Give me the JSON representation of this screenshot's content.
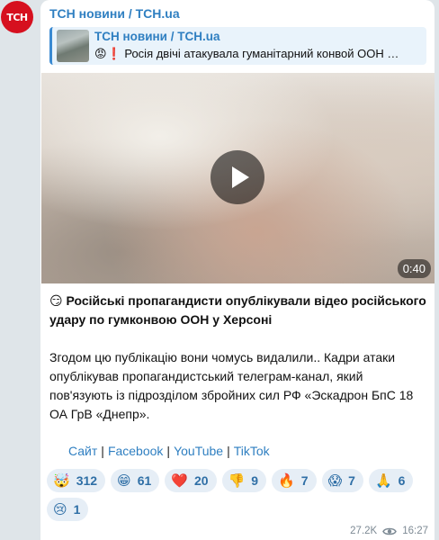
{
  "avatar_text": "ТСН",
  "channel": {
    "name": "ТСН новини / ТСН.ua"
  },
  "reply": {
    "title": "ТСН новини / ТСН.ua",
    "text": "😡❗ Росія двічі атакувала гуманітарний конвой ООН …"
  },
  "video": {
    "duration": "0:40"
  },
  "post": {
    "headline": "😏 Російські пропагандисти опублікували відео російського удару по гумконвою ООН у Херсоні",
    "body": "Згодом цю публікацію вони чомусь видалили.. Кадри атаки опублікував пропагандистський телеграм-канал, який пов'язують із підрозділом збройних сил РФ «Эскадрон БпС 18 ОА ГрВ «Днепр»."
  },
  "links": [
    "Сайт",
    "Facebook",
    "YouTube",
    "TikTok"
  ],
  "reactions": [
    {
      "emoji": "🤯",
      "count": "312"
    },
    {
      "emoji": "😁",
      "count": "61"
    },
    {
      "emoji": "❤️",
      "count": "20"
    },
    {
      "emoji": "👎",
      "count": "9"
    },
    {
      "emoji": "🔥",
      "count": "7"
    },
    {
      "emoji": "😱",
      "count": "7"
    },
    {
      "emoji": "🙏",
      "count": "6"
    },
    {
      "emoji": "😢",
      "count": "1"
    }
  ],
  "meta": {
    "views": "27.2K",
    "time": "16:27"
  }
}
